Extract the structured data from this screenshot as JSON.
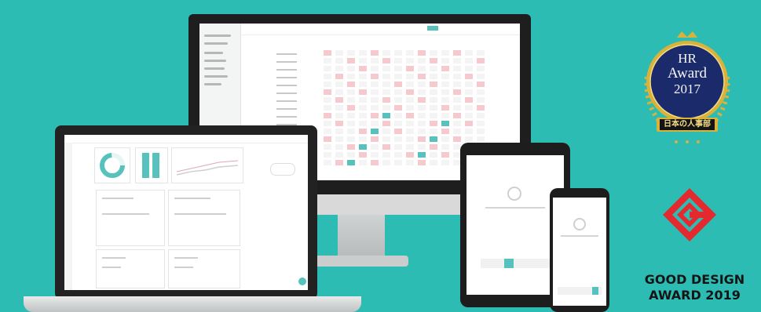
{
  "awards": {
    "hr_award": {
      "line1": "HR",
      "line2": "Award",
      "year": "2017",
      "ribbon": "日本の人事部",
      "icon": "hr-award-medal-icon"
    },
    "good_design": {
      "line1": "GOOD DESIGN",
      "line2": "AWARD 2019",
      "icon": "g-mark-icon"
    }
  },
  "colors": {
    "background": "#2dbcb3",
    "accent_teal": "#56c1bd",
    "shift_pink": "#f6c9cf",
    "medal_navy": "#1b2a6b",
    "medal_gold": "#d8b23a",
    "gmark_red": "#e4292f"
  }
}
